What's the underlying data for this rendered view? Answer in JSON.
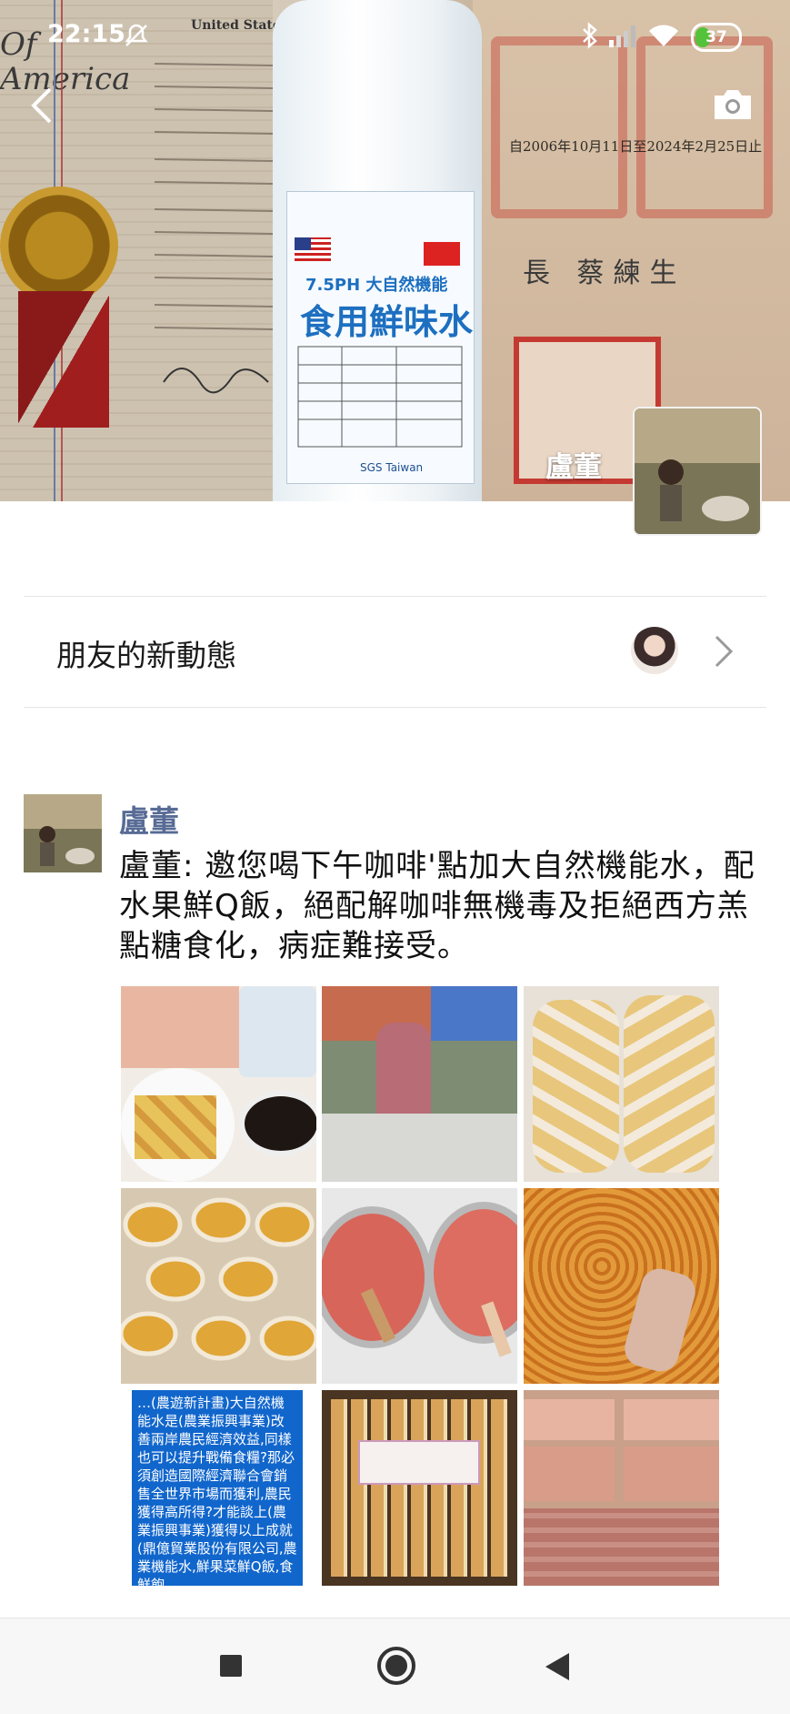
{
  "status_bar": {
    "time": "22:15",
    "battery": "37",
    "battery_percent": 37,
    "icons": [
      "mute-icon",
      "bluetooth-icon",
      "signal-icon",
      "wifi-icon",
      "battery-icon"
    ]
  },
  "cover": {
    "owner_name": "盧董",
    "bottle_caption_line1": "7.5PH 大自然機能",
    "bottle_caption_line2": "食用鮮味水",
    "bottle_sgs": "SGS Taiwan",
    "cert_heading_left": "United States Patent",
    "cert_script_left": "Of America",
    "cert_right_date": "自2006年10月11日至2024年2月25日止",
    "cert_right_name": "長 蔡練生",
    "colors": {
      "label_blue": "#1d6fc0",
      "seal_red": "#c43a32"
    }
  },
  "friends_updates": {
    "label": "朋友的新動態"
  },
  "post": {
    "author": "盧董",
    "text": "盧董: 邀您喝下午咖啡'點加大自然機能水，配水果鮮Q飯，絕配解咖啡無機毒及拒絕西方羔點糖食化，病症難接受。",
    "photos": [
      {
        "name": "photo-coffee-cakes"
      },
      {
        "name": "photo-market-stall"
      },
      {
        "name": "photo-bagged-cakes"
      },
      {
        "name": "photo-mangoes"
      },
      {
        "name": "photo-mango-puree"
      },
      {
        "name": "photo-mango-paste"
      },
      {
        "name": "photo-text-card",
        "text": "…(農遊新計畫)大自然機能水是(農業振興事業)改善兩岸農民經濟效益,同樣也可以提升戰備食糧?那必須創造國際經濟聯合會銷售全世界市場而獲利,農民獲得高所得?才能談上(農業振興事業)獲得以上成就(鼎億貿業股份有限公司,農業機能水,鮮果菜鮮Q飯,食鮮飽"
      },
      {
        "name": "photo-boxed-cakes"
      },
      {
        "name": "photo-gift-boxes"
      }
    ]
  },
  "nav": {
    "buttons": [
      "recent-apps-button",
      "home-button",
      "back-nav-button"
    ]
  }
}
